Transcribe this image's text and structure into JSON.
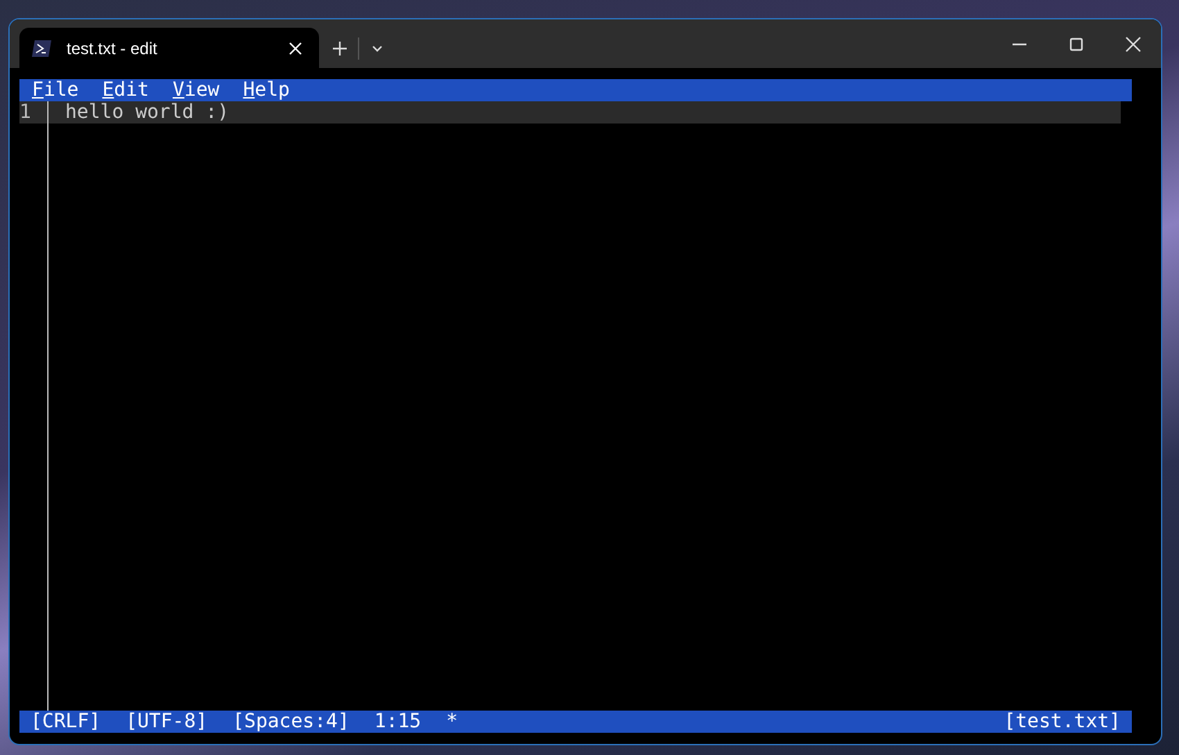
{
  "window": {
    "tab_title": "test.txt - edit"
  },
  "menu": [
    {
      "label": "File"
    },
    {
      "label": "Edit"
    },
    {
      "label": "View"
    },
    {
      "label": "Help"
    }
  ],
  "editor": {
    "lines": [
      {
        "number": "1",
        "text": "hello world :)",
        "current": true
      }
    ]
  },
  "status_bar": {
    "left": [
      "[CRLF]",
      "[UTF-8]",
      "[Spaces:4]",
      "1:15",
      "*"
    ],
    "right": "[test.txt]"
  }
}
